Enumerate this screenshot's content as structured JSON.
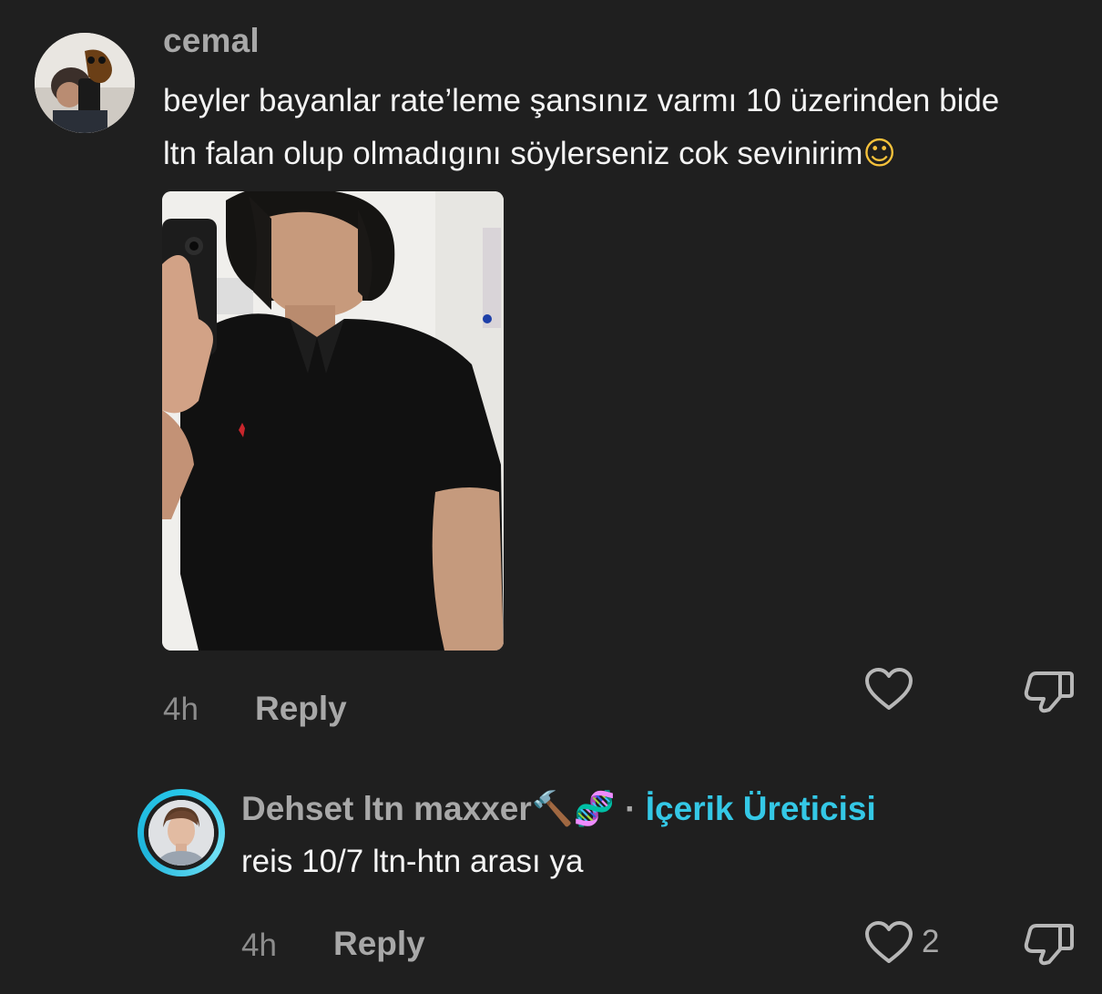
{
  "comment": {
    "username": "cemal",
    "text_line1": "beyler bayanlar rate’leme şansınız varmı 10 üzerinden bide",
    "text_line2": "ltn falan olup olmadıgını söylerseniz cok sevinirim",
    "text_emoji": "☺",
    "time": "4h",
    "reply_label": "Reply",
    "like_icon": "heart-outline-icon",
    "dislike_icon": "thumbs-down-outline-icon"
  },
  "reply": {
    "username": "Dehset ltn maxxer",
    "username_emojis": "🔨🧬",
    "separator": "·",
    "badge": "İçerik Üreticisi",
    "text": "reis 10/7 ltn-htn arası ya",
    "time": "4h",
    "reply_label": "Reply",
    "like_count": "2",
    "like_icon": "heart-outline-icon",
    "dislike_icon": "thumbs-down-outline-icon"
  },
  "colors": {
    "background": "#1f1f1f",
    "muted_text": "#a8a8a8",
    "creator_accent": "#34c8e6"
  }
}
